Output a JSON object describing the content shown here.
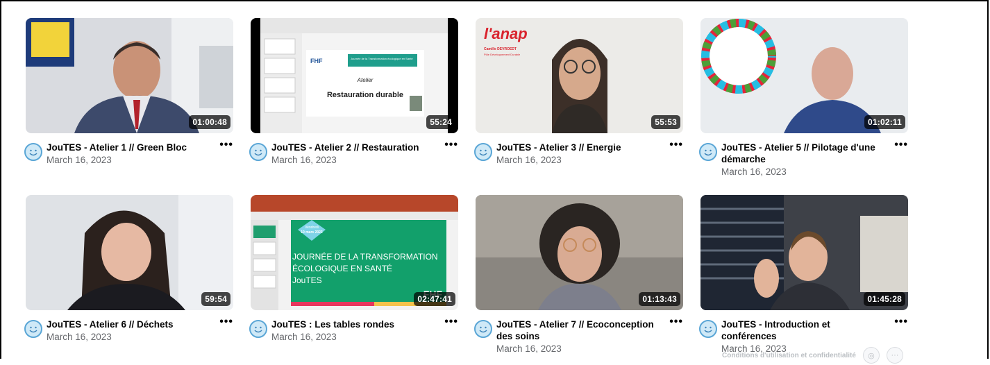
{
  "videos": [
    {
      "title": "JouTES - Atelier 1 // Green Bloc",
      "date": "March 16, 2023",
      "duration": "01:00:48"
    },
    {
      "title": "JouTES - Atelier 2 // Restauration",
      "date": "March 16, 2023",
      "duration": "55:24"
    },
    {
      "title": "JouTES - Atelier 3 // Energie",
      "date": "March 16, 2023",
      "duration": "55:53"
    },
    {
      "title": "JouTES - Atelier 5 // Pilotage d'une démarche",
      "date": "March 16, 2023",
      "duration": "01:02:11"
    },
    {
      "title": "JouTES - Atelier 6 // Déchets",
      "date": "March 16, 2023",
      "duration": "59:54"
    },
    {
      "title": "JouTES : Les tables rondes",
      "date": "March 16, 2023",
      "duration": "02:47:41"
    },
    {
      "title": "JouTES - Atelier 7 // Ecoconception des soins",
      "date": "March 16, 2023",
      "duration": "01:13:43"
    },
    {
      "title": "JouTES - Introduction et conférences",
      "date": "March 16, 2023",
      "duration": "01:45:28"
    }
  ],
  "slides": {
    "v2_org": "FHF",
    "v2_banner": "Journée de la Transformation écologique en Santé",
    "v2_sub": "Atelier",
    "v2_main": "Restauration durable",
    "v3_logo": "l'anap",
    "v3_name": "Camille DEVROEDT",
    "v3_role": "Pôle Développement Durable",
    "v6_badge_day": "Vendredi",
    "v6_badge_date": "10 mars 2023",
    "v6_line1": "JOURNÉE DE LA TRANSFORMATION",
    "v6_line2": "ÉCOLOGIQUE EN SANTÉ",
    "v6_line3": "JouTES",
    "v6_org": "FHF"
  },
  "more_label": "•••",
  "footer": {
    "text": "Conditions d'utilisation et confidentialité",
    "icon_btn": "◎",
    "more_btn": "···"
  },
  "icons": [
    "avatar-icon",
    "more-options-icon"
  ]
}
